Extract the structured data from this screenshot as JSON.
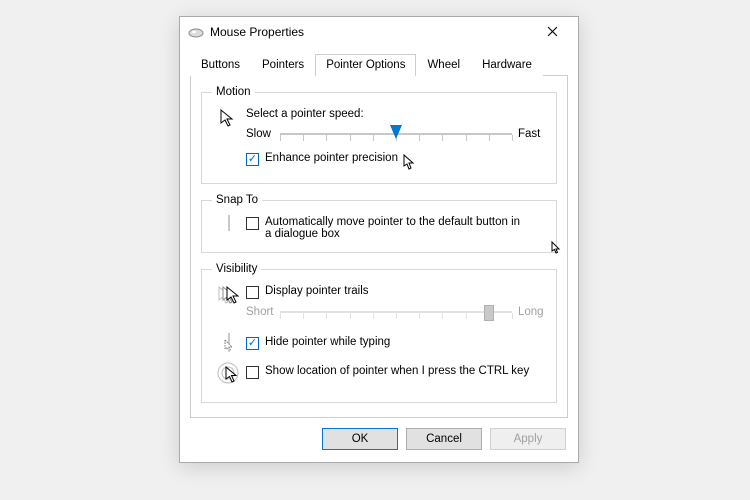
{
  "window": {
    "title": "Mouse Properties"
  },
  "tabs": {
    "items": [
      "Buttons",
      "Pointers",
      "Pointer Options",
      "Wheel",
      "Hardware"
    ],
    "active_index": 2
  },
  "motion": {
    "legend": "Motion",
    "select_label": "Select a pointer speed:",
    "slow": "Slow",
    "fast": "Fast",
    "speed_value": 6,
    "speed_min": 1,
    "speed_max": 11,
    "enhance_label": "Enhance pointer precision",
    "enhance_checked": true
  },
  "snap": {
    "legend": "Snap To",
    "label": "Automatically move pointer to the default button in a dialogue box",
    "checked": false
  },
  "visibility": {
    "legend": "Visibility",
    "trails_label": "Display pointer trails",
    "trails_checked": false,
    "short": "Short",
    "long": "Long",
    "trails_value": 10,
    "trails_min": 1,
    "trails_max": 11,
    "trails_enabled": false,
    "hide_label": "Hide pointer while typing",
    "hide_checked": true,
    "ctrl_label": "Show location of pointer when I press the CTRL key",
    "ctrl_checked": false
  },
  "footer": {
    "ok": "OK",
    "cancel": "Cancel",
    "apply": "Apply",
    "apply_enabled": false
  }
}
